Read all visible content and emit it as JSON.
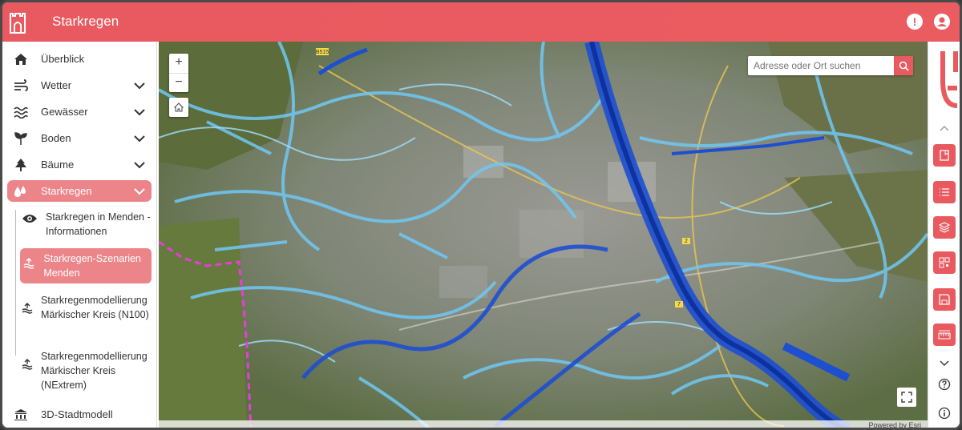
{
  "header": {
    "title": "Starkregen",
    "logo_icon": "city-gate-icon",
    "info_icon": "alert-icon",
    "user_icon": "user-icon"
  },
  "sidebar": {
    "items": [
      {
        "label": "Überblick",
        "icon": "home-icon",
        "expandable": false
      },
      {
        "label": "Wetter",
        "icon": "wind-icon",
        "expandable": true
      },
      {
        "label": "Gewässer",
        "icon": "waves-icon",
        "expandable": true
      },
      {
        "label": "Boden",
        "icon": "sprout-icon",
        "expandable": true
      },
      {
        "label": "Bäume",
        "icon": "tree-icon",
        "expandable": true
      },
      {
        "label": "Starkregen",
        "icon": "rain-drops-icon",
        "expandable": true,
        "active": true
      },
      {
        "label": "3D-Stadtmodell",
        "icon": "building-icon",
        "expandable": false
      }
    ],
    "sub_items": [
      {
        "label": "Starkregen in Menden - Informationen",
        "icon": "eye-icon"
      },
      {
        "label": "Starkregen-Szenarien Menden",
        "icon": "flood-icon",
        "active": true
      },
      {
        "label": "Starkregenmodellierung Märkischer Kreis (N100)",
        "icon": "flood-icon"
      },
      {
        "label": "Starkregenmodellierung Märkischer Kreis (NExtrem)",
        "icon": "flood-icon"
      }
    ]
  },
  "map": {
    "search_placeholder": "Adresse oder Ort suchen",
    "zoom_in": "+",
    "zoom_out": "−",
    "attribution": "Powered by Esri",
    "road_labels": [
      "B515",
      "7",
      "2"
    ]
  },
  "toolbar": {
    "buttons": [
      "bookmark-icon",
      "list-icon",
      "layers-icon",
      "qr-code-icon",
      "save-icon",
      "measure-icon"
    ],
    "chevron_up": "chevron-up-icon",
    "chevron_down": "chevron-down-icon",
    "help": "help-icon",
    "info": "info-icon"
  },
  "colors": {
    "accent": "#e85a5f",
    "active_bg": "#ec8589",
    "water_deep": "#1d4fd1",
    "water_light": "#6fc8f5",
    "boundary": "#e53fd6"
  }
}
